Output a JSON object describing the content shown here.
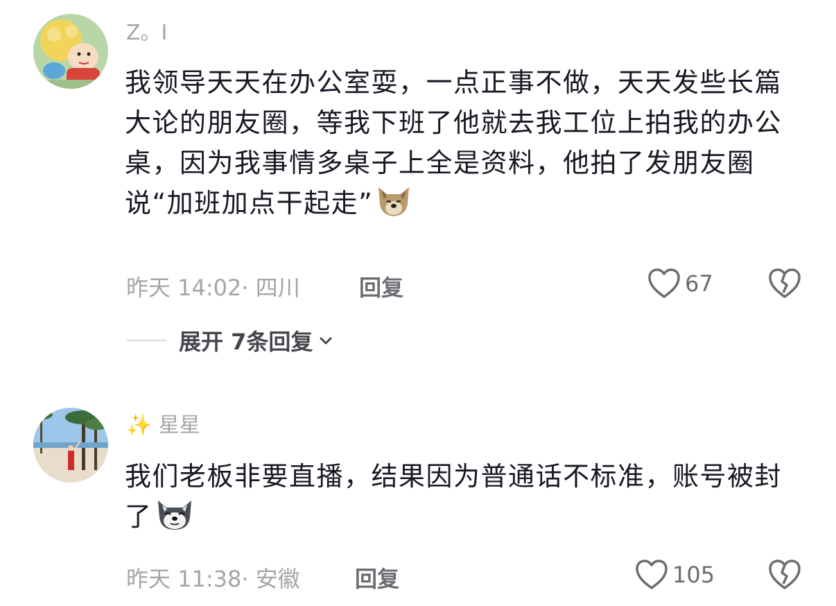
{
  "comments": [
    {
      "username": "Z。I",
      "text": "我领导天天在办公室耍，一点正事不做，天天发些长篇大论的朋友圈，等我下班了他就去我工位上拍我的办公桌，因为我事情多桌子上全是资料，他拍了发朋友圈说“加班加点干起走”",
      "emoji": "dog-face-emoji",
      "time": "昨天 14:02",
      "location": "· 四川",
      "reply_label": "回复",
      "likes": "67",
      "expand_label": "展开 7条回复"
    },
    {
      "username_prefix": "✨",
      "username": "星星",
      "text": "我们老板非要直播，结果因为普通话不标准，账号被封了",
      "emoji": "husky-face-emoji",
      "time": "昨天 11:38",
      "location": "· 安徽",
      "reply_label": "回复",
      "likes": "105"
    }
  ],
  "icons": {
    "like": "heart-outline-icon",
    "dislike": "broken-heart-icon",
    "expand": "chevron-down-icon"
  },
  "colors": {
    "text_primary": "#161823",
    "text_secondary": "#a4a4aa",
    "text_action": "#6b6b72"
  }
}
